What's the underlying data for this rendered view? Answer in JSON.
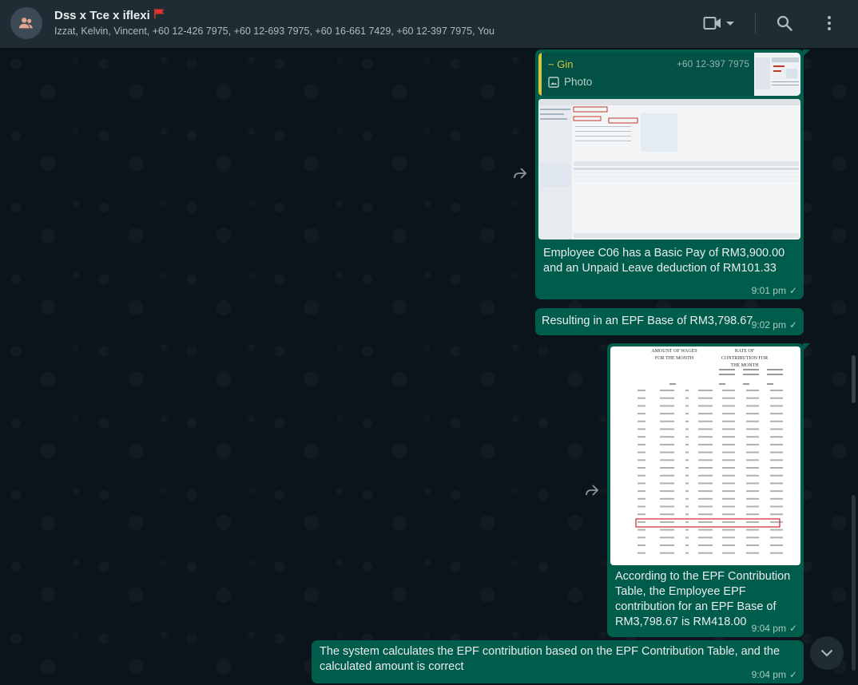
{
  "header": {
    "title": "Dss x Tce x iflexi",
    "members": "Izzat, Kelvin, Vincent, +60 12-426 7975, +60 12-693 7975, +60 16-661 7429, +60 12-397 7975, You",
    "icons": [
      "group-avatar-icon",
      "video-call-icon",
      "chevron-down-icon",
      "search-icon",
      "menu-icon"
    ]
  },
  "messages": {
    "m1": {
      "quote_name": "~ Gin",
      "quote_phone": "+60 12-397 7975",
      "quote_type": "Photo",
      "text": "Employee C06 has a Basic Pay of RM3,900.00 and an Unpaid Leave deduction of RM101.33",
      "time": "9:01 pm"
    },
    "m2": {
      "text": "Resulting in an EPF Base of RM3,798.67",
      "time": "9:02 pm"
    },
    "m3": {
      "table_header_wages": "AMOUNT OF WAGES FOR THE MONTH",
      "table_header_rate": "RATE OF CONTRIBUTION FOR THE MONTH",
      "text": "According to the EPF Contribution Table, the Employee EPF contribution for an EPF Base of RM3,798.67 is RM418.00",
      "time": "9:04 pm"
    },
    "m4": {
      "text": "The system calculates the EPF contribution based on the EPF Contribution Table, and the calculated amount is correct",
      "time": "9:04 pm"
    }
  },
  "colors": {
    "header_bg": "#202c33",
    "chat_bg": "#0b141a",
    "outgoing_bubble": "#005c4b",
    "quote_accent": "#d4c63b"
  }
}
